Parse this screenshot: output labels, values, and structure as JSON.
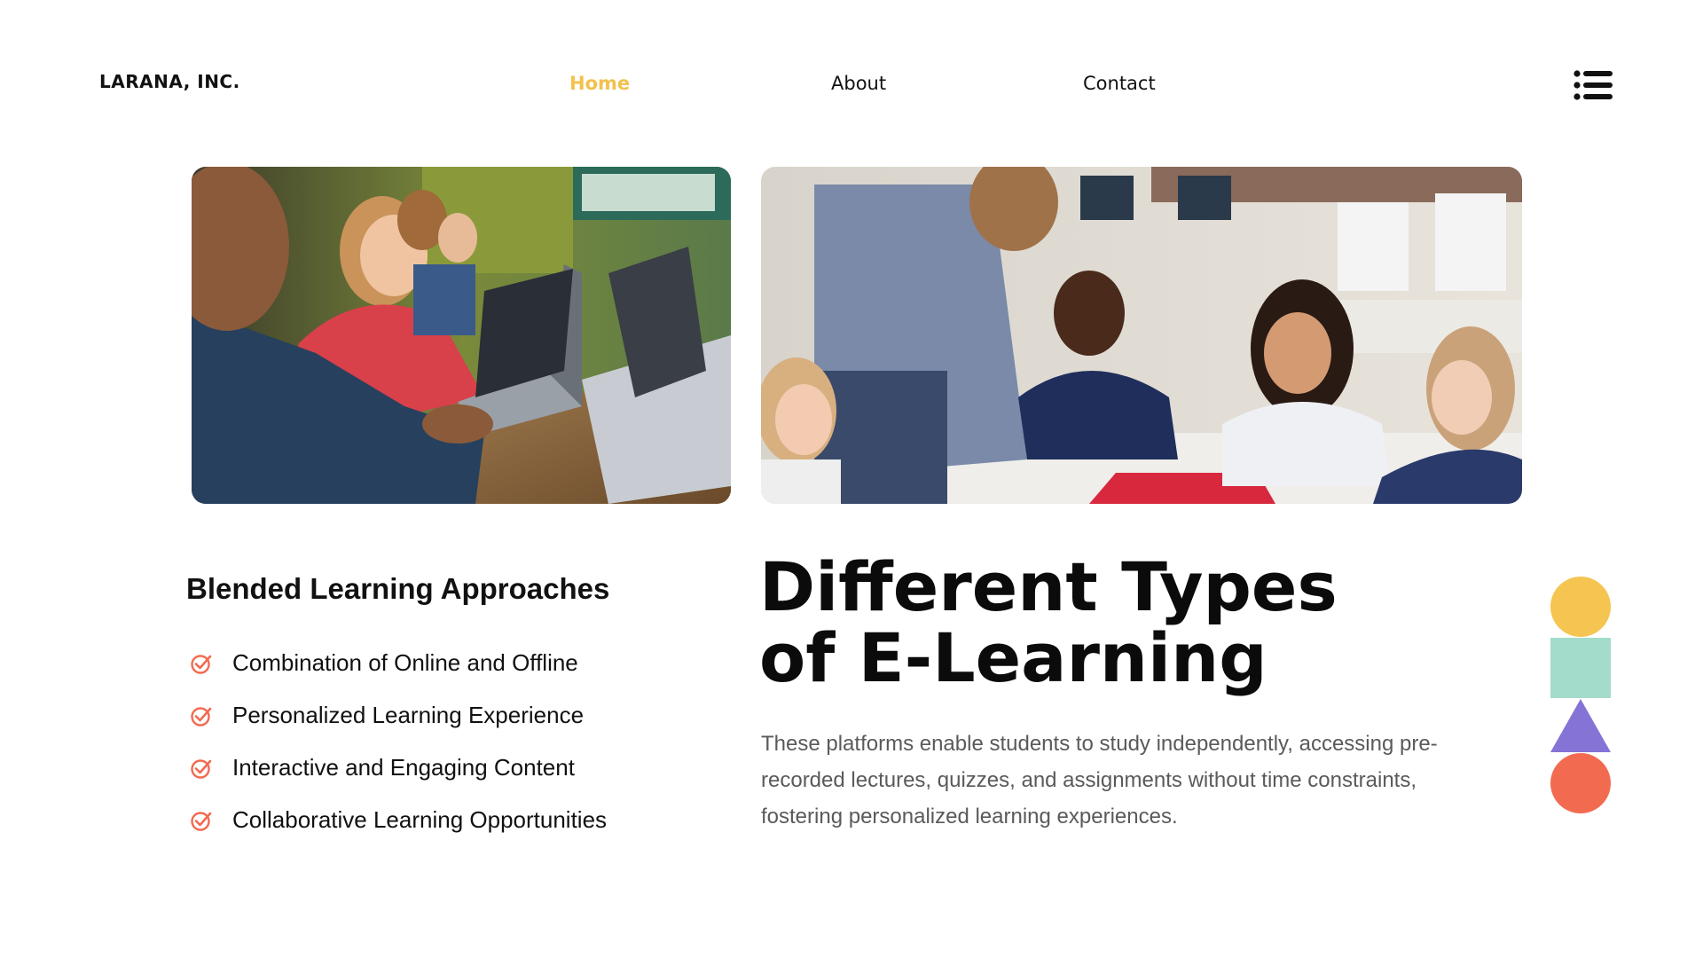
{
  "header": {
    "brand": "LARANA, INC.",
    "nav": [
      {
        "label": "Home",
        "active": true
      },
      {
        "label": "About",
        "active": false
      },
      {
        "label": "Contact",
        "active": false
      }
    ],
    "menu_icon": "hamburger-menu-icon"
  },
  "photos": [
    {
      "subject": "children-using-laptops-in-classroom"
    },
    {
      "subject": "teacher-with-students-at-table"
    }
  ],
  "left": {
    "heading": "Blended Learning Approaches",
    "items": [
      "Combination of Online and Offline",
      "Personalized Learning Experience",
      "Interactive and Engaging Content",
      "Collaborative Learning Opportunities"
    ],
    "item_icon": "check-circle-icon"
  },
  "right": {
    "title_line1": "Different Types",
    "title_line2": "of E-Learning",
    "description": "These platforms enable students to study independently, accessing pre-recorded lectures, quizzes, and assignments without time constraints, fostering personalized learning experiences."
  },
  "colors": {
    "accent_yellow": "#F2C14E",
    "check_orange": "#F26B50",
    "shape_yellow": "#F5C451",
    "shape_mint": "#A3DCCA",
    "shape_purple": "#8673D6",
    "shape_coral": "#F26B50"
  }
}
